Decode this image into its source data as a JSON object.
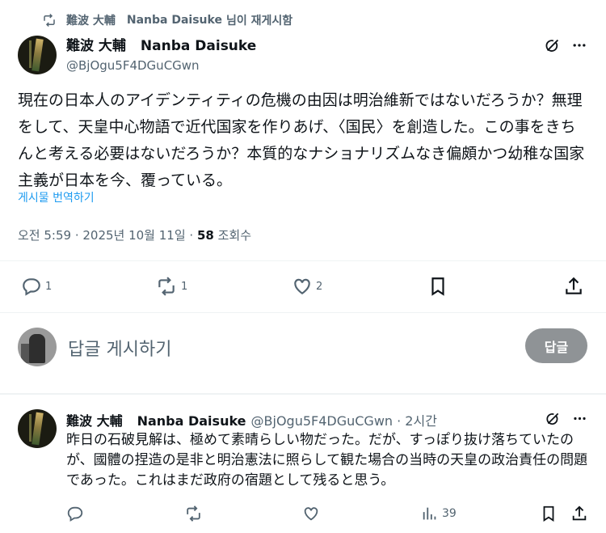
{
  "repost_header": {
    "icon": "retweet-icon",
    "name_ja": "難波 大輔",
    "name_en": "Nanba Daisuke",
    "suffix": "님이 재게시함"
  },
  "tweet": {
    "author_name_ja": "難波 大輔",
    "author_name_en": "Nanba Daisuke",
    "handle": "@BjOgu5F4DGuCGwn",
    "text": "現在の日本人のアイデンティティの危機の由因は明治維新ではないだろうか？無理をして、天皇中心物語で近代国家を作りあげ、〈国民〉を創造した。この事をきちんと考える必要はないだろうか？本質的なナショナリズムなき偏頗かつ幼稚な国家主義が日本を今、覆っている。",
    "translate_label": "게시물 번역하기",
    "timestamp": "오전 5:59 · 2025년 10월 11일 · ",
    "views": "58",
    "views_label": " 조회수",
    "actions": {
      "replies": "1",
      "reposts": "1",
      "likes": "2"
    }
  },
  "reply_composer": {
    "placeholder": "답글 게시하기",
    "button_label": "답글"
  },
  "reply": {
    "author_name_ja": "難波 大輔",
    "author_name_en": "Nanba Daisuke",
    "handle_time": "@BjOgu5F4DGuCGwn · 2시간",
    "text": "昨日の石破見解は、極めて素晴らしい物だった。だが、すっぽり抜け落ちていたのが、國體の捏造の是非と明治憲法に照らして観た場合の当時の天皇の政治責任の問題であった。これはまだ政府の宿題として残ると思う。",
    "views": "39"
  }
}
